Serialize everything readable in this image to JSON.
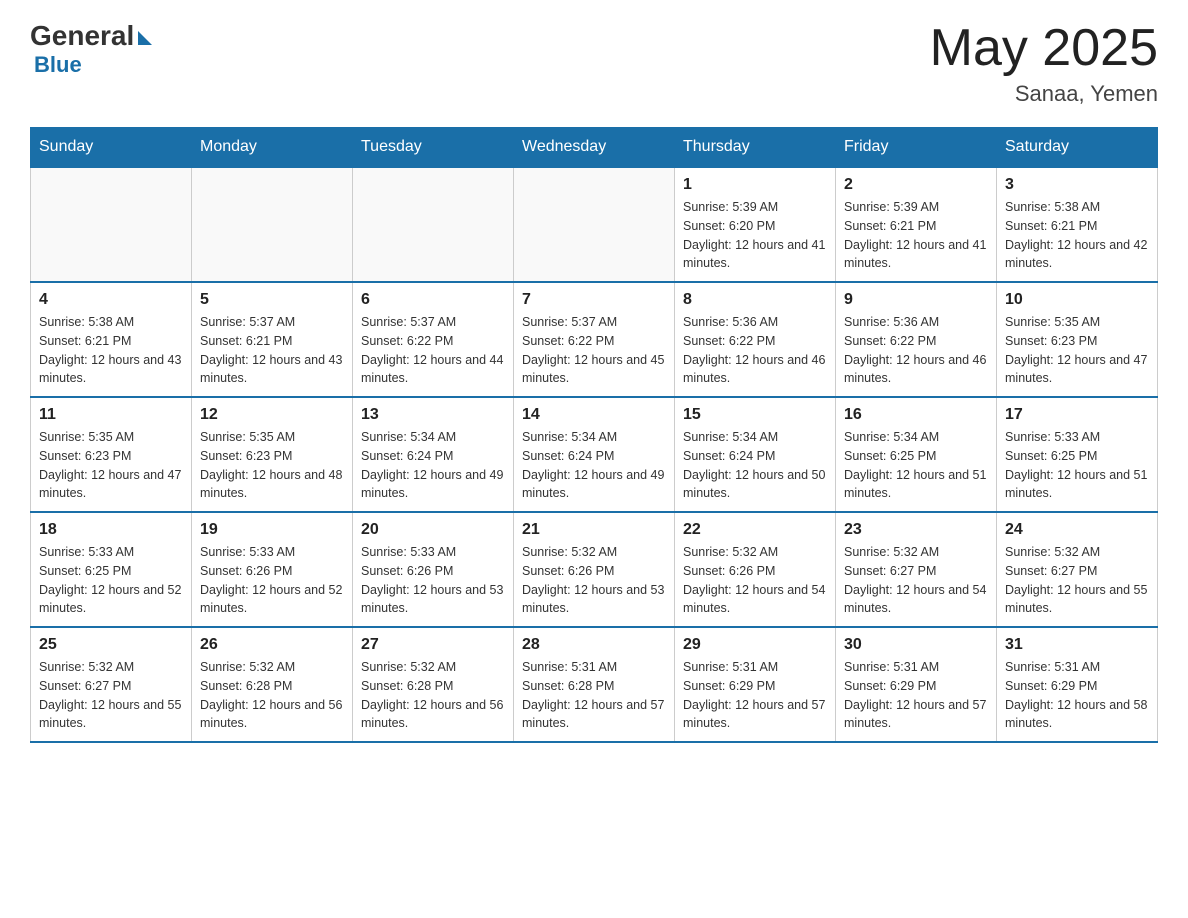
{
  "header": {
    "logo_general": "General",
    "logo_blue": "Blue",
    "month_title": "May 2025",
    "subtitle": "Sanaa, Yemen"
  },
  "days_of_week": [
    "Sunday",
    "Monday",
    "Tuesday",
    "Wednesday",
    "Thursday",
    "Friday",
    "Saturday"
  ],
  "weeks": [
    [
      {
        "day": "",
        "info": ""
      },
      {
        "day": "",
        "info": ""
      },
      {
        "day": "",
        "info": ""
      },
      {
        "day": "",
        "info": ""
      },
      {
        "day": "1",
        "info": "Sunrise: 5:39 AM\nSunset: 6:20 PM\nDaylight: 12 hours and 41 minutes."
      },
      {
        "day": "2",
        "info": "Sunrise: 5:39 AM\nSunset: 6:21 PM\nDaylight: 12 hours and 41 minutes."
      },
      {
        "day": "3",
        "info": "Sunrise: 5:38 AM\nSunset: 6:21 PM\nDaylight: 12 hours and 42 minutes."
      }
    ],
    [
      {
        "day": "4",
        "info": "Sunrise: 5:38 AM\nSunset: 6:21 PM\nDaylight: 12 hours and 43 minutes."
      },
      {
        "day": "5",
        "info": "Sunrise: 5:37 AM\nSunset: 6:21 PM\nDaylight: 12 hours and 43 minutes."
      },
      {
        "day": "6",
        "info": "Sunrise: 5:37 AM\nSunset: 6:22 PM\nDaylight: 12 hours and 44 minutes."
      },
      {
        "day": "7",
        "info": "Sunrise: 5:37 AM\nSunset: 6:22 PM\nDaylight: 12 hours and 45 minutes."
      },
      {
        "day": "8",
        "info": "Sunrise: 5:36 AM\nSunset: 6:22 PM\nDaylight: 12 hours and 46 minutes."
      },
      {
        "day": "9",
        "info": "Sunrise: 5:36 AM\nSunset: 6:22 PM\nDaylight: 12 hours and 46 minutes."
      },
      {
        "day": "10",
        "info": "Sunrise: 5:35 AM\nSunset: 6:23 PM\nDaylight: 12 hours and 47 minutes."
      }
    ],
    [
      {
        "day": "11",
        "info": "Sunrise: 5:35 AM\nSunset: 6:23 PM\nDaylight: 12 hours and 47 minutes."
      },
      {
        "day": "12",
        "info": "Sunrise: 5:35 AM\nSunset: 6:23 PM\nDaylight: 12 hours and 48 minutes."
      },
      {
        "day": "13",
        "info": "Sunrise: 5:34 AM\nSunset: 6:24 PM\nDaylight: 12 hours and 49 minutes."
      },
      {
        "day": "14",
        "info": "Sunrise: 5:34 AM\nSunset: 6:24 PM\nDaylight: 12 hours and 49 minutes."
      },
      {
        "day": "15",
        "info": "Sunrise: 5:34 AM\nSunset: 6:24 PM\nDaylight: 12 hours and 50 minutes."
      },
      {
        "day": "16",
        "info": "Sunrise: 5:34 AM\nSunset: 6:25 PM\nDaylight: 12 hours and 51 minutes."
      },
      {
        "day": "17",
        "info": "Sunrise: 5:33 AM\nSunset: 6:25 PM\nDaylight: 12 hours and 51 minutes."
      }
    ],
    [
      {
        "day": "18",
        "info": "Sunrise: 5:33 AM\nSunset: 6:25 PM\nDaylight: 12 hours and 52 minutes."
      },
      {
        "day": "19",
        "info": "Sunrise: 5:33 AM\nSunset: 6:26 PM\nDaylight: 12 hours and 52 minutes."
      },
      {
        "day": "20",
        "info": "Sunrise: 5:33 AM\nSunset: 6:26 PM\nDaylight: 12 hours and 53 minutes."
      },
      {
        "day": "21",
        "info": "Sunrise: 5:32 AM\nSunset: 6:26 PM\nDaylight: 12 hours and 53 minutes."
      },
      {
        "day": "22",
        "info": "Sunrise: 5:32 AM\nSunset: 6:26 PM\nDaylight: 12 hours and 54 minutes."
      },
      {
        "day": "23",
        "info": "Sunrise: 5:32 AM\nSunset: 6:27 PM\nDaylight: 12 hours and 54 minutes."
      },
      {
        "day": "24",
        "info": "Sunrise: 5:32 AM\nSunset: 6:27 PM\nDaylight: 12 hours and 55 minutes."
      }
    ],
    [
      {
        "day": "25",
        "info": "Sunrise: 5:32 AM\nSunset: 6:27 PM\nDaylight: 12 hours and 55 minutes."
      },
      {
        "day": "26",
        "info": "Sunrise: 5:32 AM\nSunset: 6:28 PM\nDaylight: 12 hours and 56 minutes."
      },
      {
        "day": "27",
        "info": "Sunrise: 5:32 AM\nSunset: 6:28 PM\nDaylight: 12 hours and 56 minutes."
      },
      {
        "day": "28",
        "info": "Sunrise: 5:31 AM\nSunset: 6:28 PM\nDaylight: 12 hours and 57 minutes."
      },
      {
        "day": "29",
        "info": "Sunrise: 5:31 AM\nSunset: 6:29 PM\nDaylight: 12 hours and 57 minutes."
      },
      {
        "day": "30",
        "info": "Sunrise: 5:31 AM\nSunset: 6:29 PM\nDaylight: 12 hours and 57 minutes."
      },
      {
        "day": "31",
        "info": "Sunrise: 5:31 AM\nSunset: 6:29 PM\nDaylight: 12 hours and 58 minutes."
      }
    ]
  ]
}
